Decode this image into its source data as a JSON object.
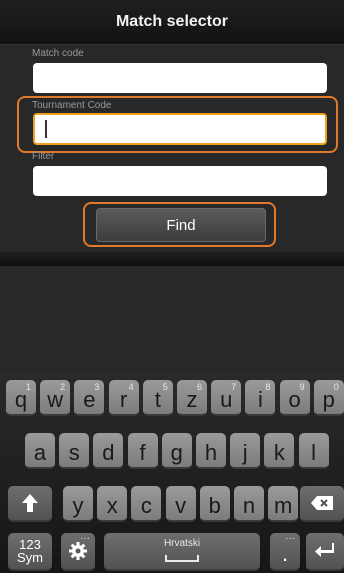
{
  "title_bar": {
    "title": "Match selector"
  },
  "form": {
    "match_code_label": "Match code",
    "match_code_value": "",
    "tournament_code_label": "Tournament Code",
    "tournament_code_value": "",
    "filter_label": "Filter",
    "filter_value": "",
    "find_button_label": "Find"
  },
  "keyboard": {
    "row1": [
      {
        "label": "q",
        "hint": "1"
      },
      {
        "label": "w",
        "hint": "2"
      },
      {
        "label": "e",
        "hint": "3"
      },
      {
        "label": "r",
        "hint": "4"
      },
      {
        "label": "t",
        "hint": "5"
      },
      {
        "label": "z",
        "hint": "6"
      },
      {
        "label": "u",
        "hint": "7"
      },
      {
        "label": "i",
        "hint": "8"
      },
      {
        "label": "o",
        "hint": "9"
      },
      {
        "label": "p",
        "hint": "0"
      }
    ],
    "row2": [
      "a",
      "s",
      "d",
      "f",
      "g",
      "h",
      "j",
      "k",
      "l"
    ],
    "row3": [
      "y",
      "x",
      "c",
      "v",
      "b",
      "n",
      "m"
    ],
    "shift_icon": "shift-arrow-icon",
    "backspace_icon": "backspace-icon",
    "sym_label_top": "123",
    "sym_label_bottom": "Sym",
    "settings_icon": "gear-icon",
    "space_label": "Hrvatski",
    "period_label": ".",
    "enter_icon": "enter-icon"
  }
}
